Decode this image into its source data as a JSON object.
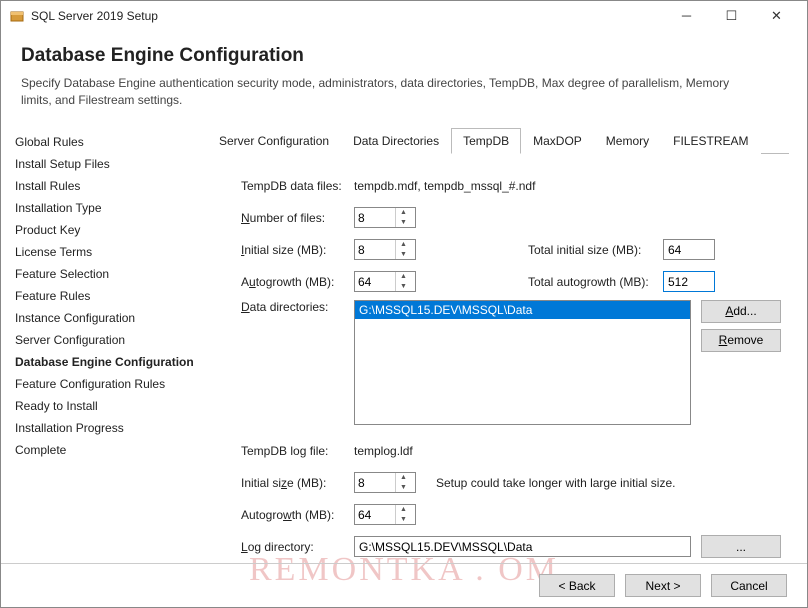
{
  "window": {
    "title": "SQL Server 2019 Setup"
  },
  "header": {
    "title": "Database Engine Configuration",
    "subtitle": "Specify Database Engine authentication security mode, administrators, data directories, TempDB, Max degree of parallelism, Memory limits, and Filestream settings."
  },
  "sidebar": {
    "items": [
      "Global Rules",
      "Install Setup Files",
      "Install Rules",
      "Installation Type",
      "Product Key",
      "License Terms",
      "Feature Selection",
      "Feature Rules",
      "Instance Configuration",
      "Server Configuration",
      "Database Engine Configuration",
      "Feature Configuration Rules",
      "Ready to Install",
      "Installation Progress",
      "Complete"
    ],
    "active_index": 10
  },
  "tabs": {
    "items": [
      "Server Configuration",
      "Data Directories",
      "TempDB",
      "MaxDOP",
      "Memory",
      "FILESTREAM"
    ],
    "active_index": 2
  },
  "tempdb": {
    "data_files_label": "TempDB data files:",
    "data_files_value": "tempdb.mdf, tempdb_mssql_#.ndf",
    "num_files_label": "Number of files:",
    "num_files_value": "8",
    "init_size_label": "Initial size (MB):",
    "init_size_value": "8",
    "total_init_label": "Total initial size (MB):",
    "total_init_value": "64",
    "autogrowth_label": "Autogrowth (MB):",
    "autogrowth_value": "64",
    "total_autogrowth_label": "Total autogrowth (MB):",
    "total_autogrowth_value": "512",
    "data_dirs_label": "Data directories:",
    "data_dirs_items": [
      "G:\\MSSQL15.DEV\\MSSQL\\Data"
    ],
    "add_btn": "Add...",
    "remove_btn": "Remove",
    "log_file_label": "TempDB log file:",
    "log_file_value": "templog.ldf",
    "log_init_label": "Initial size (MB):",
    "log_init_value": "8",
    "log_init_note": "Setup could take longer with large initial size.",
    "log_autogrowth_label": "Autogrowth (MB):",
    "log_autogrowth_value": "64",
    "log_dir_label": "Log directory:",
    "log_dir_value": "G:\\MSSQL15.DEV\\MSSQL\\Data",
    "browse_btn": "..."
  },
  "footer": {
    "back": "< Back",
    "next": "Next >",
    "cancel": "Cancel"
  },
  "watermark": "REMONTKA .  OM"
}
